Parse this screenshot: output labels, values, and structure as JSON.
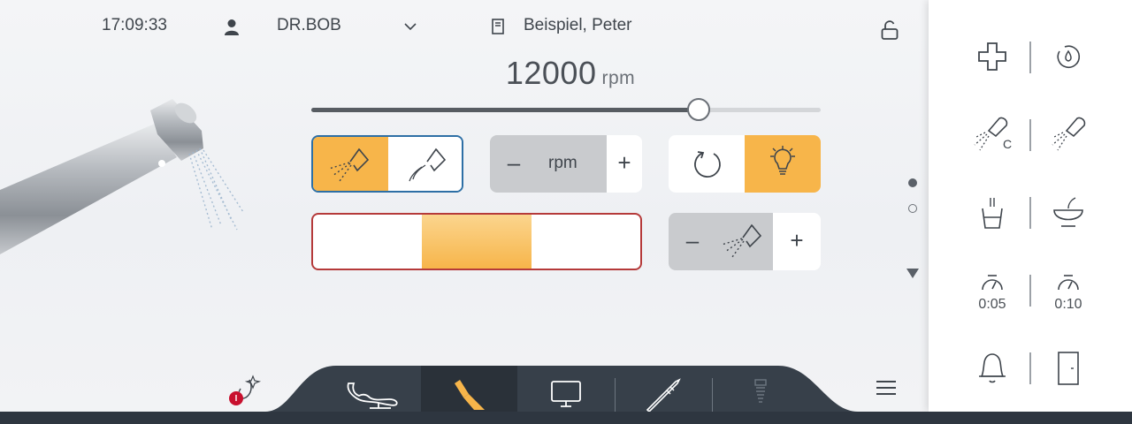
{
  "header": {
    "time": "17:09:33",
    "user": "DR.BOB",
    "patient": "Beispiel, Peter"
  },
  "speed": {
    "value": "12000",
    "unit": "rpm",
    "slider_level": 0.76
  },
  "controls": {
    "spray_modes": [
      "spray-air-water-icon",
      "spray-water-only-icon"
    ],
    "rpm_button_label": "rpm",
    "minus": "–",
    "plus": "+",
    "light_on": true
  },
  "page_indicator": {
    "pages": 2,
    "active": 0
  },
  "right_panel": {
    "timer_1": "0:05",
    "timer_2": "0:10"
  },
  "tabs": [
    "chair-tab",
    "instrument-tab",
    "monitor-tab",
    "scaler-tab",
    "implant-tab"
  ],
  "colors": {
    "accent_orange": "#f7b54a",
    "selection_border": "#2d6fa5",
    "alert_border": "#b53a3a",
    "bar_dark": "#2e3640",
    "alert_dot": "#c8102e"
  }
}
